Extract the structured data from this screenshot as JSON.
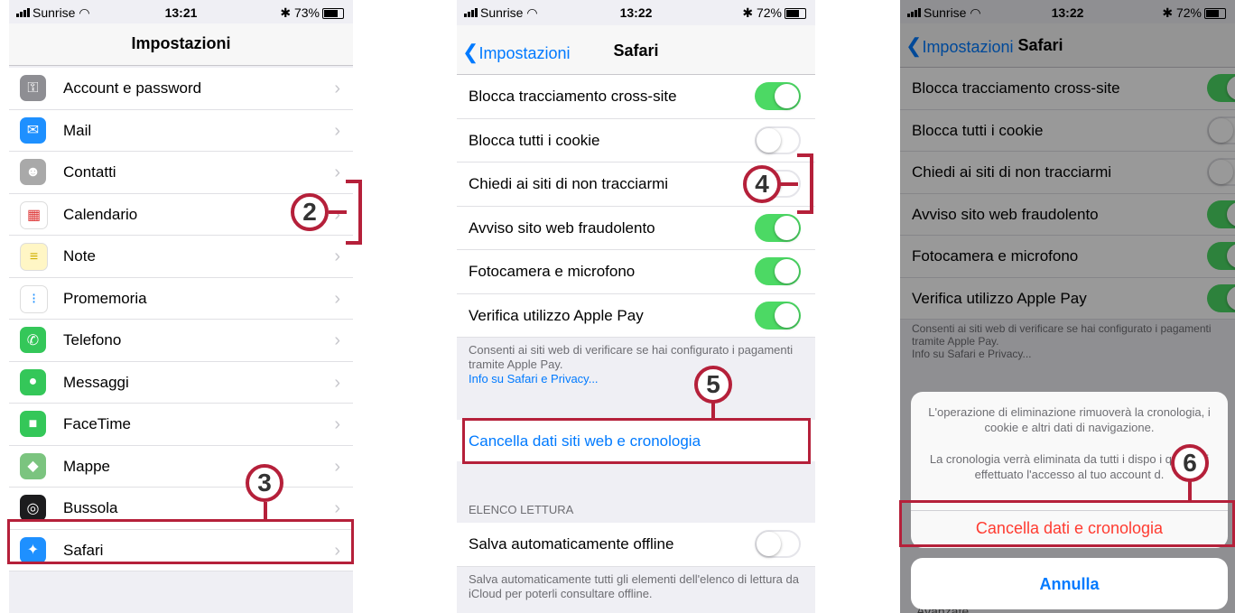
{
  "colors": {
    "accent": "#007aff",
    "toggle_on": "#4cd964",
    "destructive": "#ff3b30",
    "annotation": "#b5203a"
  },
  "status1": {
    "carrier": "Sunrise",
    "time": "13:21",
    "battery": "73%",
    "battery_level": 0.73
  },
  "status2": {
    "carrier": "Sunrise",
    "time": "13:22",
    "battery": "72%",
    "battery_level": 0.72
  },
  "status3": {
    "carrier": "Sunrise",
    "time": "13:22",
    "battery": "72%",
    "battery_level": 0.72
  },
  "settings": {
    "title": "Impostazioni",
    "items": [
      {
        "label": "Account e password",
        "icon": "key-icon",
        "color": "#8e8e93"
      },
      {
        "label": "Mail",
        "icon": "envelope-icon",
        "color": "#1e90ff"
      },
      {
        "label": "Contatti",
        "icon": "contacts-icon",
        "color": "#a9a9a9"
      },
      {
        "label": "Calendario",
        "icon": "calendar-icon",
        "color": "#ffffff"
      },
      {
        "label": "Note",
        "icon": "notes-icon",
        "color": "#fff6c5"
      },
      {
        "label": "Promemoria",
        "icon": "reminders-icon",
        "color": "#ffffff"
      },
      {
        "label": "Telefono",
        "icon": "phone-icon",
        "color": "#34c759"
      },
      {
        "label": "Messaggi",
        "icon": "message-icon",
        "color": "#34c759"
      },
      {
        "label": "FaceTime",
        "icon": "video-icon",
        "color": "#34c759"
      },
      {
        "label": "Mappe",
        "icon": "map-icon",
        "color": "#7bc47f"
      },
      {
        "label": "Bussola",
        "icon": "compass-icon",
        "color": "#1c1c1e"
      },
      {
        "label": "Safari",
        "icon": "safari-icon",
        "color": "#1e90ff"
      }
    ]
  },
  "safari": {
    "back": "Impostazioni",
    "title": "Safari",
    "toggles": [
      {
        "label": "Blocca tracciamento cross-site",
        "on": true
      },
      {
        "label": "Blocca tutti i cookie",
        "on": false
      },
      {
        "label": "Chiedi ai siti di non tracciarmi",
        "on": false
      },
      {
        "label": "Avviso sito web fraudolento",
        "on": true
      },
      {
        "label": "Fotocamera e microfono",
        "on": true
      },
      {
        "label": "Verifica utilizzo Apple Pay",
        "on": true
      }
    ],
    "applepay_footer": "Consenti ai siti web di verificare se hai configurato i pagamenti tramite Apple Pay.",
    "privacy_link": "Info su Safari e Privacy...",
    "clear_label": "Cancella dati siti web e cronologia",
    "reading_header": "ELENCO LETTURA",
    "offline_label": "Salva automaticamente offline",
    "offline_on": false,
    "offline_footer": "Salva automaticamente tutti gli elementi dell'elenco di lettura da iCloud per poterli consultare offline."
  },
  "sheet": {
    "message1": "L'operazione di eliminazione rimuoverà la cronologia, i cookie e altri dati di navigazione.",
    "message2": "La cronologia verrà eliminata da tutti i dispo     i quali hai effettuato l'accesso al tuo account     d.",
    "destructive": "Cancella dati e cronologia",
    "cancel": "Annulla",
    "behind_partial": "Avanzate"
  },
  "annotations": {
    "b2": "2",
    "b3": "3",
    "b4": "4",
    "b5": "5",
    "b6": "6"
  }
}
